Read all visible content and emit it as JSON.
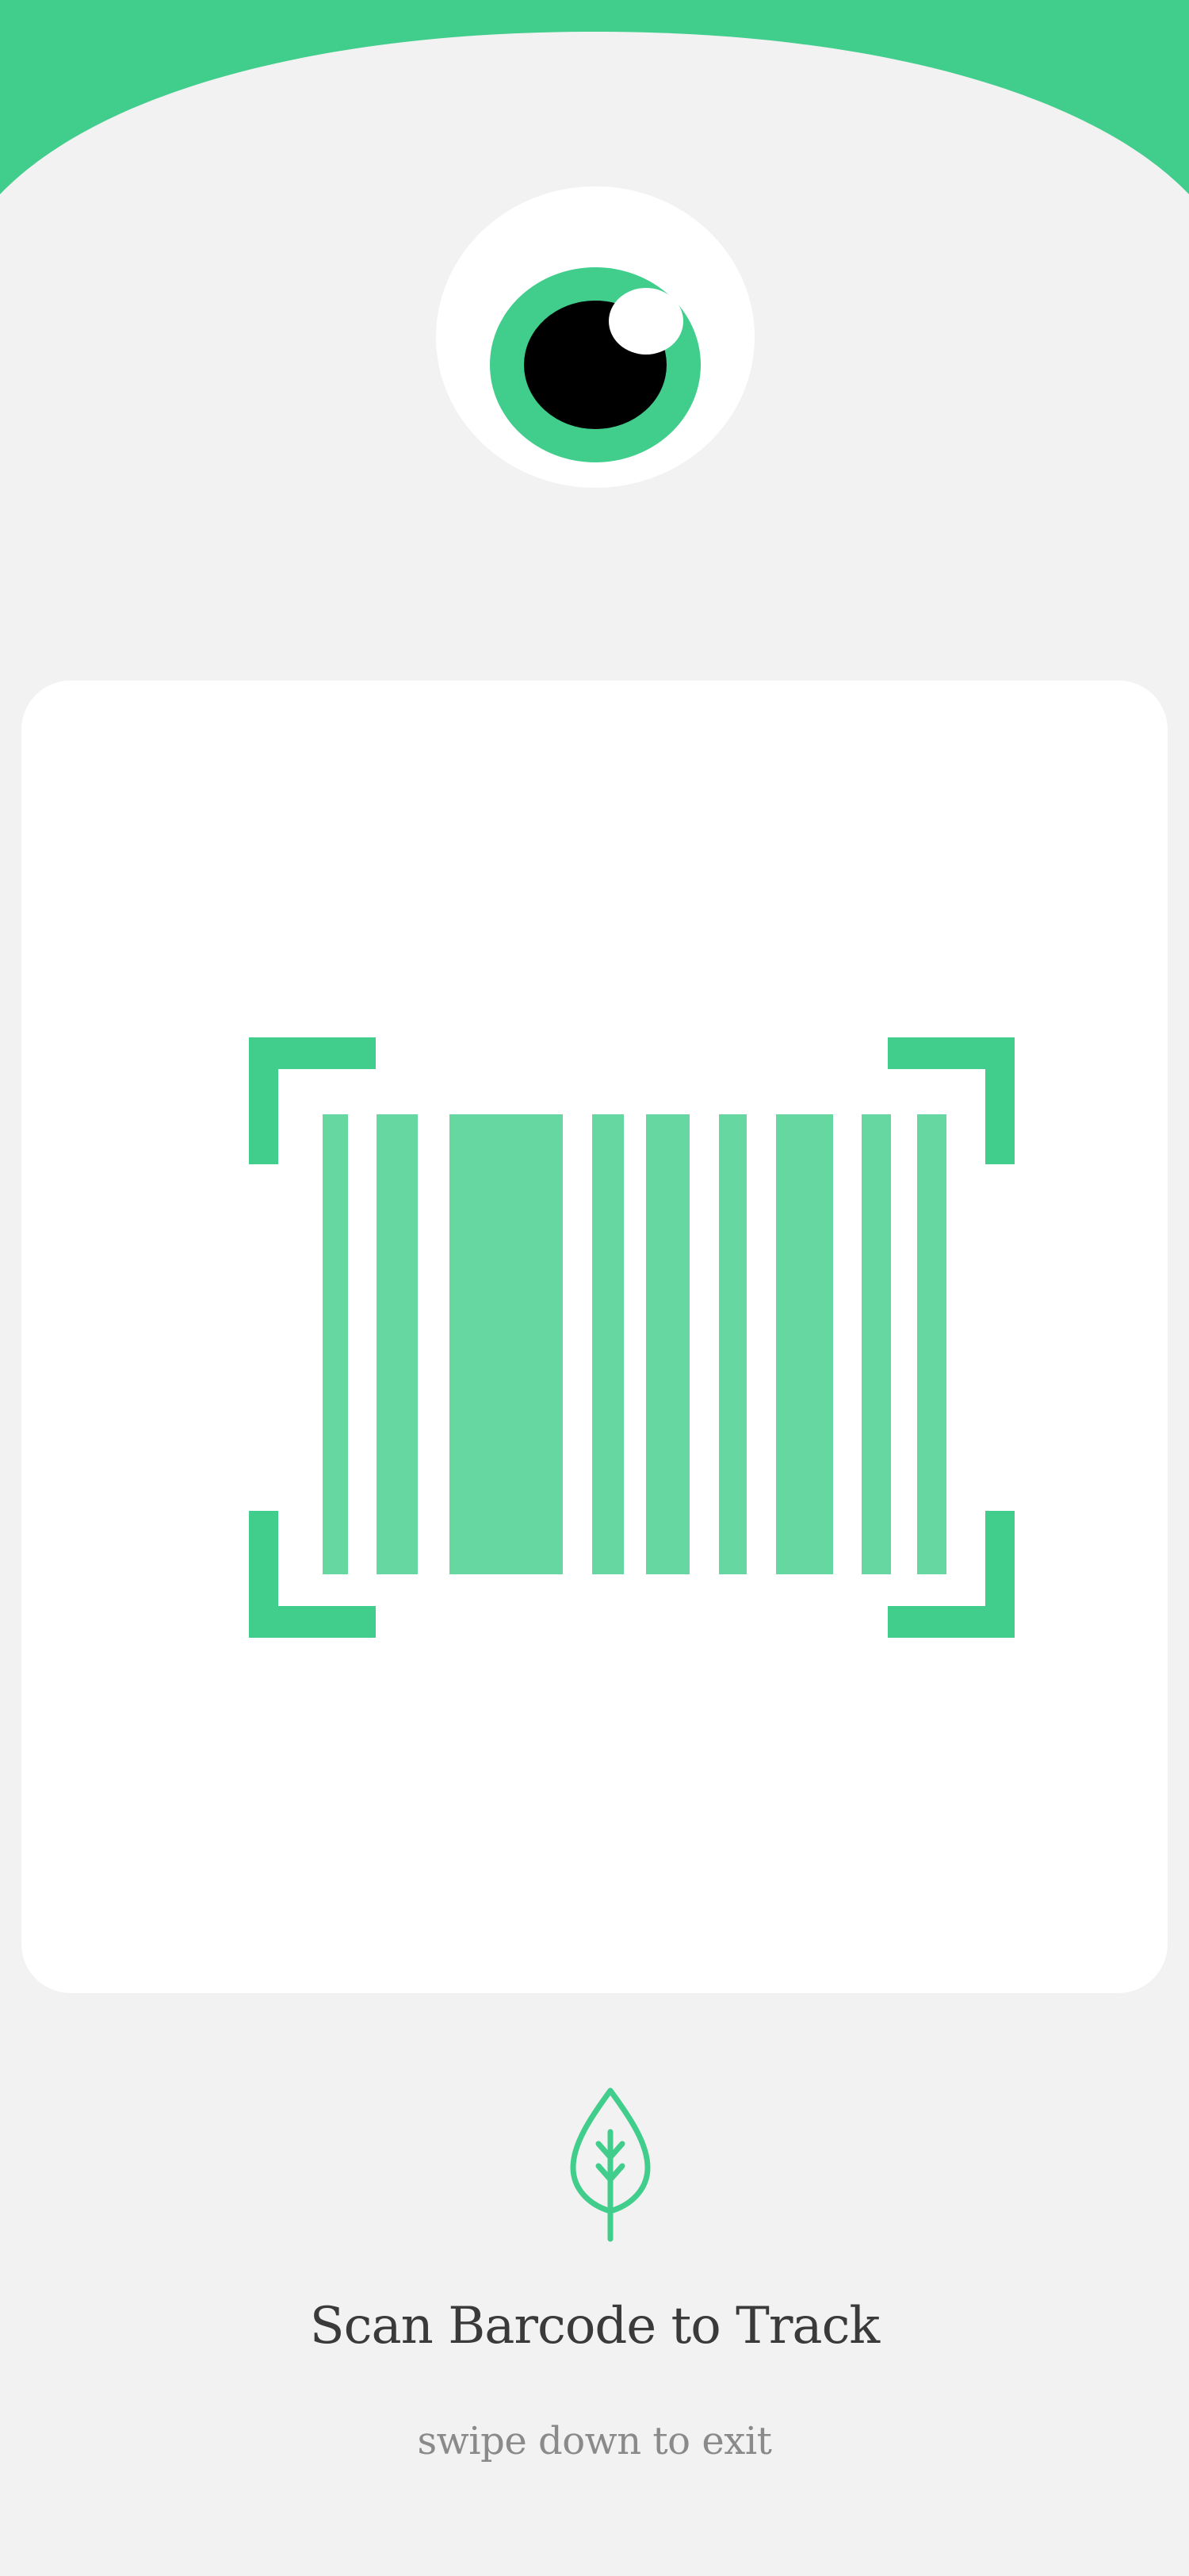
{
  "colors": {
    "accent": "#41cd8c",
    "barcode": "#66d7a1",
    "background": "#f2f2f2",
    "card": "#ffffff",
    "title_text": "#3a3a3a",
    "subtitle_text": "#8a8a8a"
  },
  "icons": {
    "mascot": "eye-icon",
    "scanner": "barcode-scan-icon",
    "leaf": "leaf-icon"
  },
  "scan": {
    "title": "Scan Barcode to Track",
    "hint": "swipe down to exit"
  }
}
